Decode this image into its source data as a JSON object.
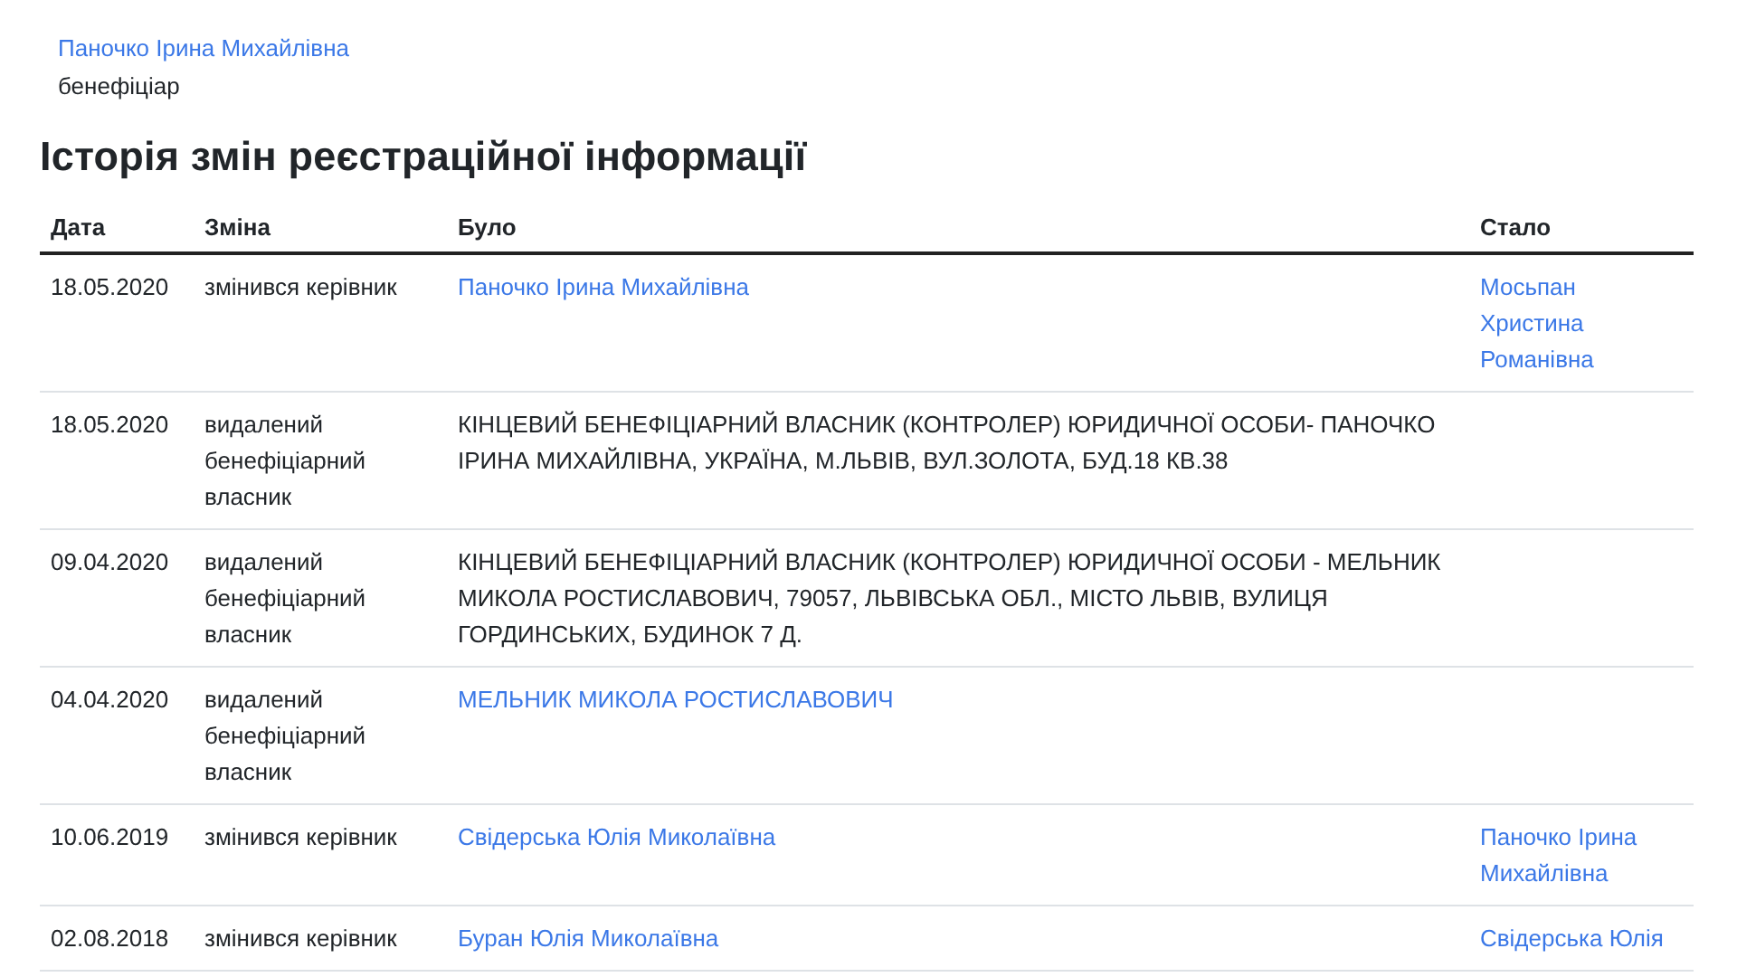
{
  "person": {
    "name": "Паночко Ірина Михайлівна",
    "role": "бенефіціар"
  },
  "title": "Історія змін реєстраційної інформації",
  "table": {
    "columns": [
      "Дата",
      "Зміна",
      "Було",
      "Стало"
    ],
    "rows": [
      {
        "date": "18.05.2020",
        "change": "змінився керівник",
        "was": {
          "kind": "link",
          "text": "Паночко Ірина Михайлівна"
        },
        "became": {
          "kind": "link",
          "text": "Мосьпан Христина Романівна"
        }
      },
      {
        "date": "18.05.2020",
        "change": "видалений бенефіціарний власник",
        "was": {
          "kind": "text",
          "text": "КІНЦЕВИЙ БЕНЕФІЦІАРНИЙ ВЛАСНИК (КОНТРОЛЕР) ЮРИДИЧНОЇ ОСОБИ- ПАНОЧКО ІРИНА МИХАЙЛІВНА, УКРАЇНА, М.ЛЬВІВ, ВУЛ.ЗОЛОТА, БУД.18 КВ.38"
        }
      },
      {
        "date": "09.04.2020",
        "change": "видалений бенефіціарний власник",
        "was": {
          "kind": "text",
          "text": "КІНЦЕВИЙ БЕНЕФІЦІАРНИЙ ВЛАСНИК (КОНТРОЛЕР) ЮРИДИЧНОЇ ОСОБИ - МЕЛЬНИК МИКОЛА РОСТИСЛАВОВИЧ, 79057, ЛЬВІВСЬКА ОБЛ., МІСТО ЛЬВІВ, ВУЛИЦЯ ГОРДИНСЬКИХ, БУДИНОК 7 Д."
        }
      },
      {
        "date": "04.04.2020",
        "change": "видалений бенефіціарний власник",
        "was": {
          "kind": "link",
          "text": "МЕЛЬНИК МИКОЛА РОСТИСЛАВОВИЧ"
        }
      },
      {
        "date": "10.06.2019",
        "change": "змінився керівник",
        "was": {
          "kind": "link",
          "text": "Свідерська Юлія Миколаївна"
        },
        "became": {
          "kind": "link",
          "text": "Паночко Ірина Михайлівна"
        }
      },
      {
        "date": "02.08.2018",
        "change": "змінився керівник",
        "was": {
          "kind": "link",
          "text": "Буран Юлія Миколаївна"
        },
        "became": {
          "kind": "link",
          "text": "Свідерська Юлія"
        }
      }
    ]
  }
}
